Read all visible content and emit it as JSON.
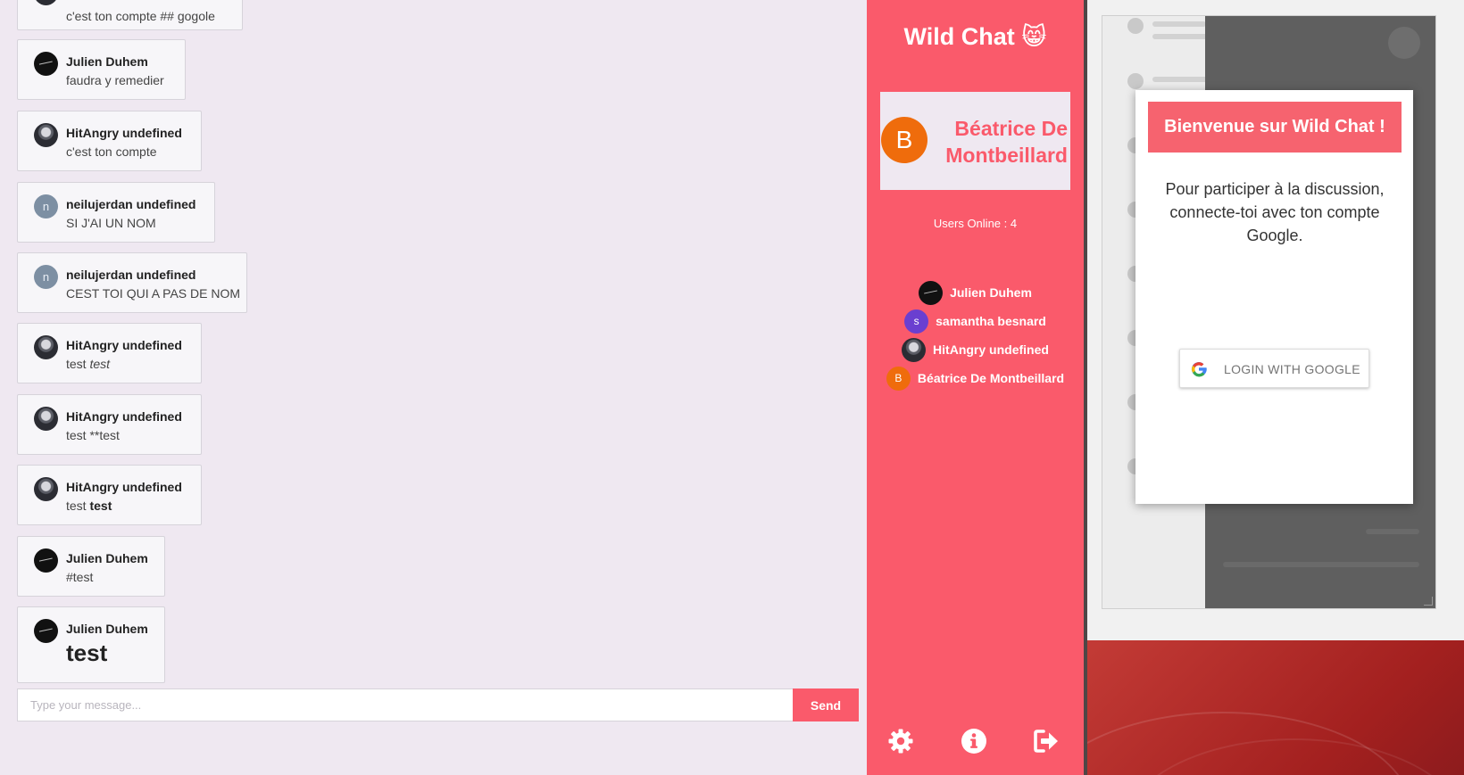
{
  "chat": {
    "messages": [
      {
        "author": "",
        "text": "c'est ton compte ## gogole"
      },
      {
        "author": "Julien Duhem",
        "text": "faudra y remedier"
      },
      {
        "author": "HitAngry undefined",
        "text": "c'est ton compte"
      },
      {
        "author": "neilujerdan undefined",
        "initial": "n",
        "text": "SI J'AI UN NOM"
      },
      {
        "author": "neilujerdan undefined",
        "initial": "n",
        "text": "CEST TOI QUI A PAS DE NOM"
      },
      {
        "author": "HitAngry undefined",
        "text_plain": "test ",
        "text_italic": "test"
      },
      {
        "author": "HitAngry undefined",
        "text": "test **test"
      },
      {
        "author": "HitAngry undefined",
        "text_plain": "test ",
        "text_bold": "test"
      },
      {
        "author": "Julien Duhem",
        "text": "#test"
      },
      {
        "author": "Julien Duhem",
        "text": "test"
      }
    ],
    "input_placeholder": "Type your message...",
    "input_value": "",
    "send_label": "Send"
  },
  "sidebar": {
    "app_title": "Wild Chat 😸",
    "current_user": {
      "initial": "B",
      "name": "Béatrice De Montbeillard"
    },
    "users_online": "Users Online : 4",
    "users": [
      {
        "name": "Julien Duhem",
        "initial": ""
      },
      {
        "name": "samantha besnard",
        "initial": "s"
      },
      {
        "name": "HitAngry undefined",
        "initial": ""
      },
      {
        "name": "Béatrice De Montbeillard",
        "initial": "B"
      }
    ],
    "footer_icons": [
      "gear-icon",
      "info-icon",
      "sign-out-icon"
    ]
  },
  "preview": {
    "modal_title": "Bienvenue sur Wild Chat !",
    "modal_text": "Pour participer à la discussion, connecte-toi avec ton compte Google.",
    "google_button_label": "LOGIN WITH GOOGLE"
  },
  "colors": {
    "accent": "#fa5a6b",
    "background": "#efe8f1",
    "avatar_orange": "#ef6c0c",
    "avatar_purple": "#6a3fd0",
    "avatar_grey": "#7d8fa3"
  }
}
